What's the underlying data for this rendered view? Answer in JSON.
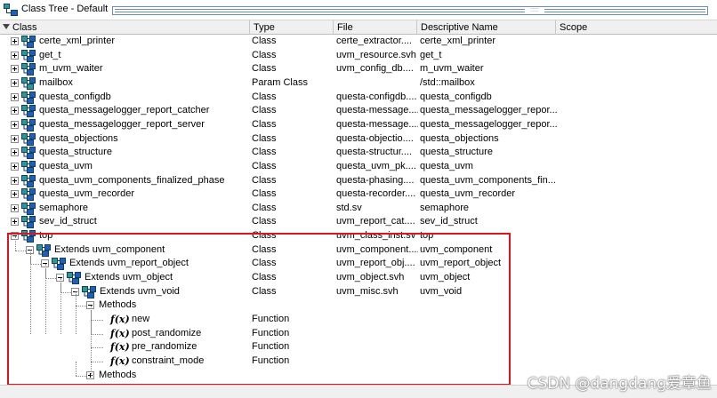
{
  "window": {
    "title": "Class Tree - Default",
    "icon": "class-tree-icon"
  },
  "columns": {
    "class": "Class",
    "type": "Type",
    "file": "File",
    "descriptive_name": "Descriptive Name",
    "scope": "Scope"
  },
  "rows": [
    {
      "expander": "plus",
      "icon": "class-icon",
      "label": "certe_xml_printer",
      "type": "Class",
      "file": "certe_extractor....",
      "desc": "certe_xml_printer"
    },
    {
      "expander": "plus",
      "icon": "class-icon",
      "label": "get_t",
      "type": "Class",
      "file": "uvm_resource.svh",
      "desc": "get_t"
    },
    {
      "expander": "plus",
      "icon": "class-icon",
      "label": "m_uvm_waiter",
      "type": "Class",
      "file": "uvm_config_db....",
      "desc": "m_uvm_waiter"
    },
    {
      "expander": "plus",
      "icon": "param-class-icon",
      "label": "mailbox",
      "type": "Param Class",
      "file": "",
      "desc": "/std::mailbox"
    },
    {
      "expander": "plus",
      "icon": "class-icon",
      "label": "questa_configdb",
      "type": "Class",
      "file": "questa-configdb....",
      "desc": "questa_configdb"
    },
    {
      "expander": "plus",
      "icon": "class-icon",
      "label": "questa_messagelogger_report_catcher",
      "type": "Class",
      "file": "questa-message....",
      "desc": "questa_messagelogger_repor..."
    },
    {
      "expander": "plus",
      "icon": "class-icon",
      "label": "questa_messagelogger_report_server",
      "type": "Class",
      "file": "questa-message....",
      "desc": "questa_messagelogger_repor..."
    },
    {
      "expander": "plus",
      "icon": "class-icon",
      "label": "questa_objections",
      "type": "Class",
      "file": "questa-objectio....",
      "desc": "questa_objections"
    },
    {
      "expander": "plus",
      "icon": "class-icon",
      "label": "questa_structure",
      "type": "Class",
      "file": "questa-structur....",
      "desc": "questa_structure"
    },
    {
      "expander": "plus",
      "icon": "class-icon",
      "label": "questa_uvm",
      "type": "Class",
      "file": "questa_uvm_pk....",
      "desc": "questa_uvm"
    },
    {
      "expander": "plus",
      "icon": "class-icon",
      "label": "questa_uvm_components_finalized_phase",
      "type": "Class",
      "file": "questa-phasing....",
      "desc": "questa_uvm_components_fin..."
    },
    {
      "expander": "plus",
      "icon": "class-icon",
      "label": "questa_uvm_recorder",
      "type": "Class",
      "file": "questa-recorder....",
      "desc": "questa_uvm_recorder"
    },
    {
      "expander": "plus",
      "icon": "class-icon",
      "label": "semaphore",
      "type": "Class",
      "file": "std.sv",
      "desc": "semaphore"
    },
    {
      "expander": "plus",
      "icon": "class-icon",
      "label": "sev_id_struct",
      "type": "Class",
      "file": "uvm_report_cat....",
      "desc": "sev_id_struct"
    },
    {
      "expander": "minus",
      "icon": "class-icon",
      "label": "top",
      "type": "Class",
      "file": "uvm_class_inst.sv",
      "desc": "top"
    },
    {
      "expander": "minus",
      "icon": "class-icon",
      "label": "Extends  uvm_component",
      "type": "Class",
      "file": "uvm_component....",
      "desc": "uvm_component"
    },
    {
      "expander": "minus",
      "icon": "class-icon",
      "label": "Extends  uvm_report_object",
      "type": "Class",
      "file": "uvm_report_obj....",
      "desc": "uvm_report_object"
    },
    {
      "expander": "minus",
      "icon": "class-icon",
      "label": "Extends  uvm_object",
      "type": "Class",
      "file": "uvm_object.svh",
      "desc": "uvm_object"
    },
    {
      "expander": "minus",
      "icon": "class-icon",
      "label": "Extends  uvm_void",
      "type": "Class",
      "file": "uvm_misc.svh",
      "desc": "uvm_void"
    },
    {
      "expander": "minus",
      "icon": "",
      "label": "Methods",
      "type": "",
      "file": "",
      "desc": ""
    },
    {
      "expander": "",
      "icon": "function-icon",
      "label": "new",
      "type": "Function",
      "file": "",
      "desc": ""
    },
    {
      "expander": "",
      "icon": "function-icon",
      "label": "post_randomize",
      "type": "Function",
      "file": "",
      "desc": ""
    },
    {
      "expander": "",
      "icon": "function-icon",
      "label": "pre_randomize",
      "type": "Function",
      "file": "",
      "desc": ""
    },
    {
      "expander": "",
      "icon": "function-icon",
      "label": "constraint_mode",
      "type": "Function",
      "file": "",
      "desc": ""
    },
    {
      "expander": "plus",
      "icon": "",
      "label": "Methods",
      "type": "",
      "file": "",
      "desc": ""
    }
  ],
  "function_glyph": "f(x)",
  "watermark": "CSDN @dangdang爱章鱼",
  "colors": {
    "highlight_border": "#e0151b",
    "icon_blue": "#1f5fb4",
    "icon_teal": "#2a9a8a",
    "title_lines": "#6b8cc0"
  }
}
